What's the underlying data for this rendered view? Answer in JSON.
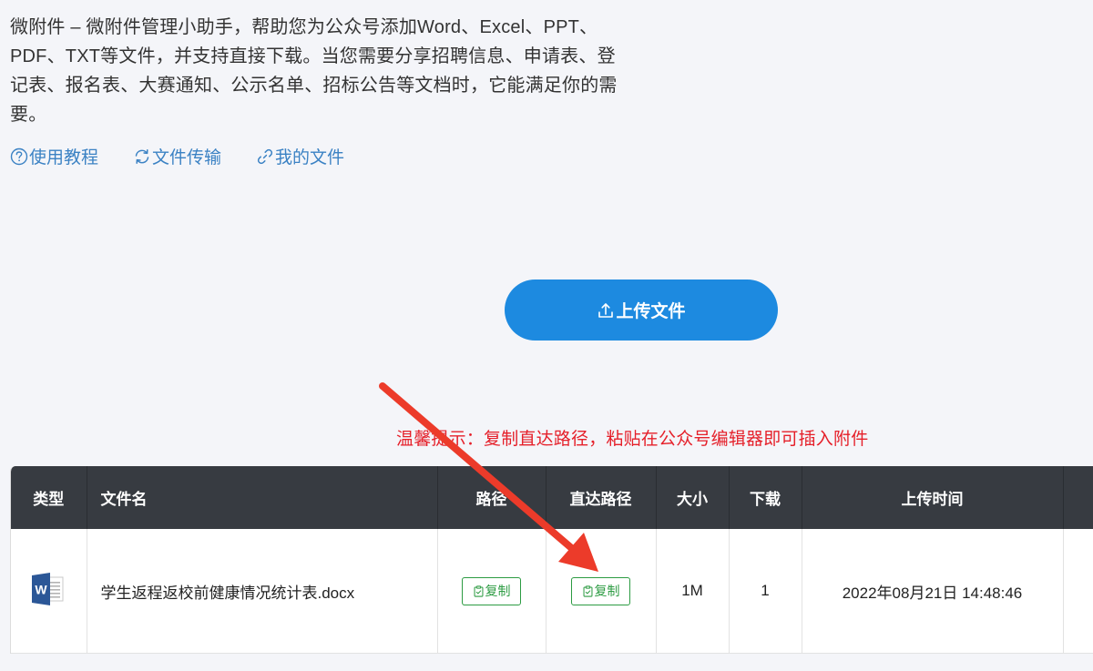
{
  "intro": {
    "text": "微附件 – 微附件管理小助手，帮助您为公众号添加Word、Excel、PPT、PDF、TXT等文件，并支持直接下载。当您需要分享招聘信息、申请表、登记表、报名表、大赛通知、公示名单、招标公告等文档时，它能满足你的需要。"
  },
  "nav": {
    "tutorial": "使用教程",
    "transfer": "文件传输",
    "my_files": "我的文件"
  },
  "upload": {
    "label": "上传文件"
  },
  "tip": {
    "text": "温馨提示：复制直达路径，粘贴在公众号编辑器即可插入附件"
  },
  "table": {
    "headers": {
      "type": "类型",
      "filename": "文件名",
      "path": "路径",
      "direct_path": "直达路径",
      "size": "大小",
      "downloads": "下载",
      "upload_time": "上传时间"
    },
    "rows": [
      {
        "filename": "学生返程返校前健康情况统计表.docx",
        "path_btn": "复制",
        "direct_btn": "复制",
        "size": "1M",
        "downloads": "1",
        "upload_time": "2022年08月21日 14:48:46"
      }
    ]
  },
  "colors": {
    "accent": "#1d8ae0",
    "link": "#3b82c4",
    "tip": "#e5202a",
    "copy_green": "#2c9b42",
    "header_bg": "#373b41",
    "arrow": "#ec3b2a",
    "word_blue": "#2b5797"
  },
  "icons": {
    "tutorial": "help-circle-icon",
    "transfer": "refresh-icon",
    "my_files": "link-icon",
    "upload": "upload-icon",
    "copy": "clipboard-icon",
    "file_type": "word-icon"
  }
}
